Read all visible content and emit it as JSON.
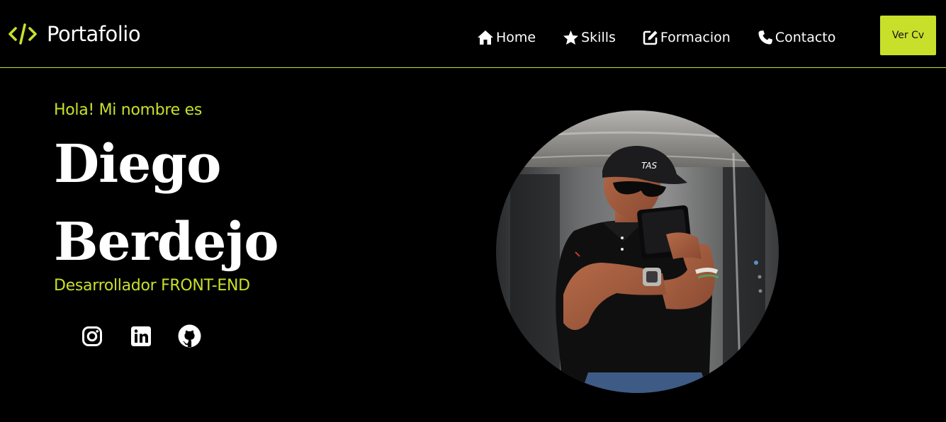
{
  "header": {
    "brand": {
      "icon": "code-icon",
      "name": "Portafolio"
    },
    "nav": [
      {
        "label": "Home",
        "icon": "home-icon"
      },
      {
        "label": "Skills",
        "icon": "star-icon"
      },
      {
        "label": "Formacion",
        "icon": "edit-icon"
      },
      {
        "label": "Contacto",
        "icon": "phone-icon"
      }
    ],
    "cv_button": "Ver Cv"
  },
  "hero": {
    "greeting": "Hola! Mi nombre es",
    "first_name": "Diego",
    "last_name": "Berdejo",
    "role": "Desarrollador FRONT-END",
    "socials": [
      {
        "icon": "instagram-icon"
      },
      {
        "icon": "linkedin-icon"
      },
      {
        "icon": "github-icon"
      }
    ],
    "photo_text": "TAS"
  },
  "colors": {
    "background": "#000000",
    "accent": "#c8e02a",
    "text": "#ffffff"
  }
}
